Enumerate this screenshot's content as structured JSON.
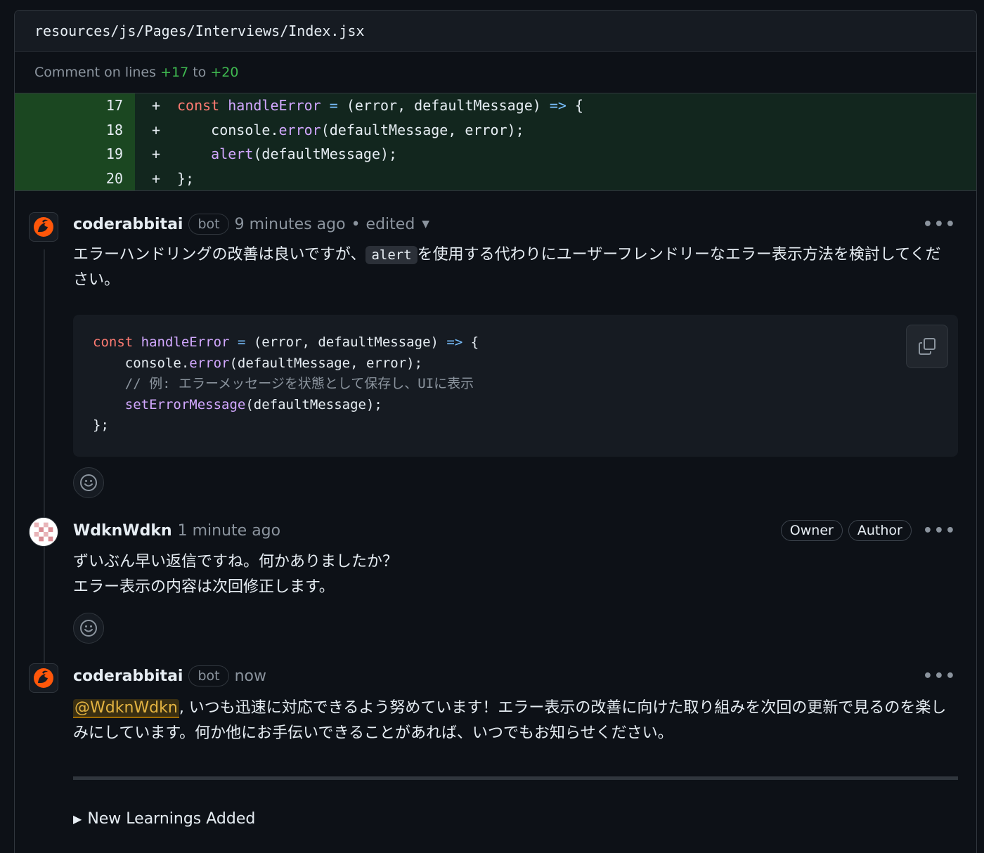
{
  "file": {
    "path": "resources/js/Pages/Interviews/Index.jsx"
  },
  "comment_on": {
    "prefix": "Comment on lines",
    "from": "+17",
    "mid": "to",
    "to": "+20"
  },
  "diff": {
    "lines": [
      {
        "num": "17",
        "sign": "+"
      },
      {
        "num": "18",
        "sign": "+"
      },
      {
        "num": "19",
        "sign": "+"
      },
      {
        "num": "20",
        "sign": "+"
      }
    ]
  },
  "comments": [
    {
      "author": "coderabbitai",
      "badge": "bot",
      "time": "9 minutes ago",
      "dot": "•",
      "edited": "edited",
      "body_pre": "エラーハンドリングの改善は良いですが、",
      "inline_code": "alert",
      "body_post": "を使用する代わりにユーザーフレンドリーなエラー表示方法を検討してください。",
      "code_comment": "// 例: エラーメッセージを状態として保存し、UIに表示"
    },
    {
      "author": "WdknWdkn",
      "time": "1 minute ago",
      "roles": [
        "Owner",
        "Author"
      ],
      "line1": "ずいぶん早い返信ですね。何かありましたか？",
      "line2": "エラー表示の内容は次回修正します。"
    },
    {
      "author": "coderabbitai",
      "badge": "bot",
      "time": "now",
      "mention": "@WdknWdkn",
      "body": ", いつも迅速に対応できるよう努めています！エラー表示の改善に向けた取り組みを次回の更新で見るのを楽しみにしています。何か他にお手伝いできることがあれば、いつでもお知らせください。",
      "details_label": "New Learnings Added"
    }
  ],
  "icons": {
    "more": "kebab-horizontal-icon",
    "copy": "copy-icon",
    "reaction": "smiley-icon",
    "caret": "triangle-down-icon",
    "details": "triangle-right-icon"
  },
  "colors": {
    "bg": "#0d1117",
    "diff_add_bg": "#12261e",
    "diff_add_num_bg": "#1b4721",
    "keyword": "#ff7b72",
    "function": "#d2a8ff",
    "operator": "#79c0ff",
    "green": "#3fb950",
    "mention": "#e3b341"
  }
}
